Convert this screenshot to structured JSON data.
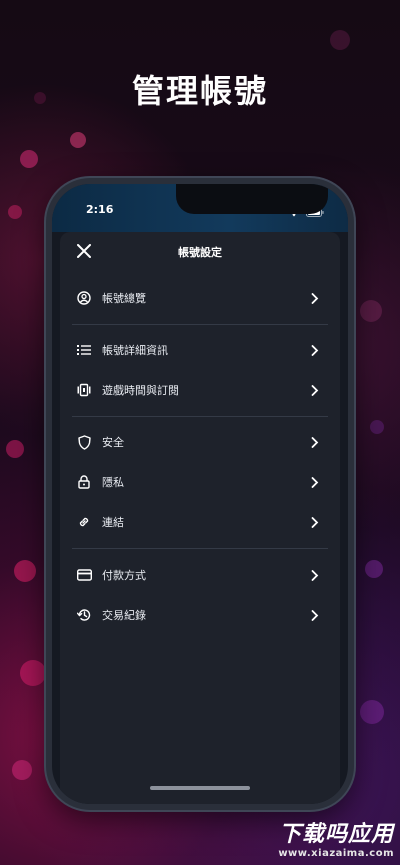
{
  "hero": {
    "title": "管理帳號"
  },
  "status_bar": {
    "time": "2:16"
  },
  "sheet": {
    "title": "帳號設定",
    "groups": [
      {
        "items": [
          {
            "label": "帳號總覽",
            "icon": "account-circle-icon"
          }
        ]
      },
      {
        "items": [
          {
            "label": "帳號詳細資訊",
            "icon": "list-icon"
          },
          {
            "label": "遊戲時間與訂閱",
            "icon": "subscription-icon"
          }
        ]
      },
      {
        "items": [
          {
            "label": "安全",
            "icon": "shield-icon"
          },
          {
            "label": "隱私",
            "icon": "lock-icon"
          },
          {
            "label": "連結",
            "icon": "link-icon"
          }
        ]
      },
      {
        "items": [
          {
            "label": "付款方式",
            "icon": "credit-card-icon"
          },
          {
            "label": "交易紀錄",
            "icon": "history-icon"
          }
        ]
      }
    ]
  },
  "watermark": {
    "main": "下载吗应用",
    "url": "www.xiazaima.com"
  },
  "colors": {
    "sheet_bg": "#1e222b",
    "screen_bg": "#151922",
    "accent_text": "#ffffff"
  }
}
